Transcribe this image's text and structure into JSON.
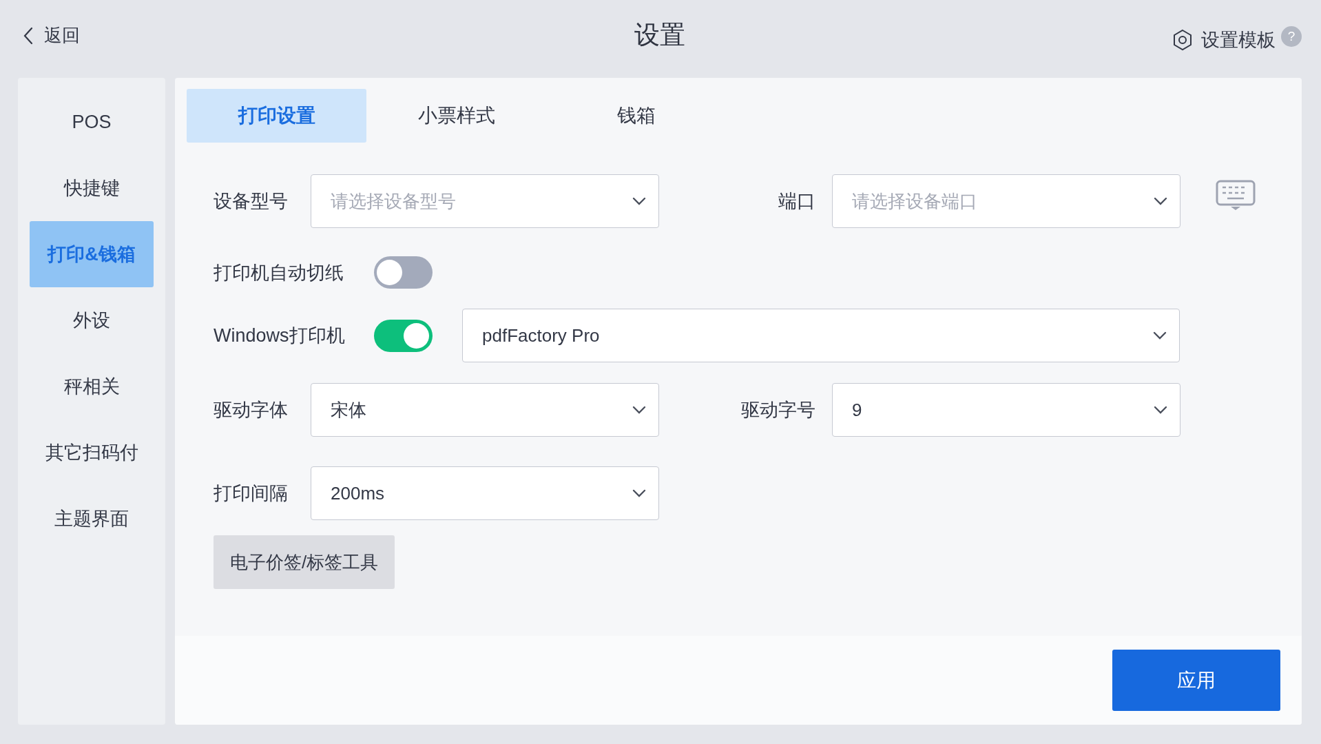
{
  "header": {
    "back": "返回",
    "title": "设置",
    "template_link": "设置模板",
    "help": "?"
  },
  "sidebar": {
    "items": [
      {
        "label": "POS",
        "selected": false
      },
      {
        "label": "快捷键",
        "selected": false
      },
      {
        "label": "打印&钱箱",
        "selected": true
      },
      {
        "label": "外设",
        "selected": false
      },
      {
        "label": "秤相关",
        "selected": false
      },
      {
        "label": "其它扫码付",
        "selected": false
      },
      {
        "label": "主题界面",
        "selected": false
      }
    ]
  },
  "tabs": [
    {
      "label": "打印设置",
      "selected": true
    },
    {
      "label": "小票样式",
      "selected": false
    },
    {
      "label": "钱箱",
      "selected": false
    }
  ],
  "form": {
    "rows": [
      {
        "kind": "select-pair",
        "fields": [
          {
            "label": "设备型号",
            "placeholder": "请选择设备型号"
          },
          {
            "label": "端口",
            "placeholder": "请选择设备端口"
          }
        ]
      },
      {
        "kind": "toggle",
        "label": "打印机自动切纸",
        "on": false
      },
      {
        "kind": "toggle-select",
        "label": "Windows打印机",
        "on": true,
        "value": "pdfFactory Pro"
      },
      {
        "kind": "select-pair",
        "fields": [
          {
            "label": "驱动字体",
            "value": "宋体"
          },
          {
            "label": "驱动字号",
            "value": "9"
          }
        ]
      },
      {
        "kind": "select",
        "label": "打印间隔",
        "value": "200ms"
      },
      {
        "kind": "button",
        "label": "电子价签/标签工具"
      }
    ]
  },
  "footer": {
    "apply": "应用"
  }
}
